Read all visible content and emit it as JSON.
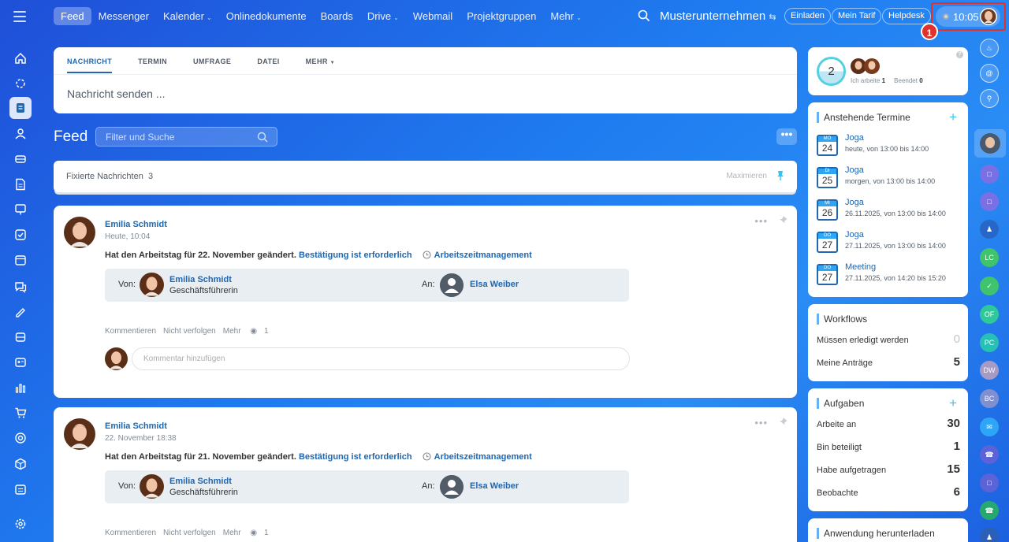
{
  "topbar": {
    "nav": [
      {
        "label": "Feed",
        "active": true,
        "caret": false
      },
      {
        "label": "Messenger",
        "caret": false
      },
      {
        "label": "Kalender",
        "caret": true
      },
      {
        "label": "Onlinedokumente",
        "caret": false
      },
      {
        "label": "Boards",
        "caret": false
      },
      {
        "label": "Drive",
        "caret": true
      },
      {
        "label": "Webmail",
        "caret": false
      },
      {
        "label": "Projektgruppen",
        "caret": false
      },
      {
        "label": "Mehr",
        "caret": true
      }
    ],
    "company": "Musterunternehmen",
    "invite": "Einladen",
    "tariff": "Mein Tarif",
    "helpdesk": "Helpdesk",
    "time": "10:05",
    "step_badge": "1"
  },
  "composer": {
    "tabs": [
      "NACHRICHT",
      "TERMIN",
      "UMFRAGE",
      "DATEI",
      "MEHR"
    ],
    "placeholder": "Nachricht senden ..."
  },
  "feed": {
    "title": "Feed",
    "filter_placeholder": "Filter und Suche",
    "more": "•••",
    "pinned": {
      "label": "Fixierte Nachrichten",
      "count": "3",
      "maximize": "Maximieren"
    },
    "posts": [
      {
        "author": "Emilia Schmidt",
        "date": "Heute, 10:04",
        "message": "Hat den Arbeitstag für 22. November geändert.",
        "confirm": "Bestätigung ist erforderlich",
        "module": "Arbeitszeitmanagement",
        "from_label": "Von:",
        "from_name": "Emilia Schmidt",
        "from_role": "Geschäftsführerin",
        "to_label": "An:",
        "to_name": "Elsa Weiber",
        "actions": [
          "Kommentieren",
          "Nicht verfolgen",
          "Mehr"
        ],
        "views": "1",
        "comment_placeholder": "Kommentar hinzufügen"
      },
      {
        "author": "Emilia Schmidt",
        "date": "22. November 18:38",
        "message": "Hat den Arbeitstag für 21. November geändert.",
        "confirm": "Bestätigung ist erforderlich",
        "module": "Arbeitszeitmanagement",
        "from_label": "Von:",
        "from_name": "Emilia Schmidt",
        "from_role": "Geschäftsführerin",
        "to_label": "An:",
        "to_name": "Elsa Weiber",
        "actions": [
          "Kommentieren",
          "Nicht verfolgen",
          "Mehr"
        ],
        "views": "1"
      }
    ]
  },
  "right": {
    "worktime": {
      "count": "2",
      "working_label": "Ich arbeite",
      "working": "1",
      "finished_label": "Beendet",
      "finished": "0"
    },
    "events": {
      "title": "Anstehende Termine",
      "items": [
        {
          "day": "MO",
          "date": "24",
          "name": "Joga",
          "time": "heute, von 13:00 bis 14:00"
        },
        {
          "day": "DI",
          "date": "25",
          "name": "Joga",
          "time": "morgen, von 13:00 bis 14:00"
        },
        {
          "day": "MI",
          "date": "26",
          "name": "Joga",
          "time": "26.11.2025, von 13:00 bis 14:00"
        },
        {
          "day": "DO",
          "date": "27",
          "name": "Joga",
          "time": "27.11.2025, von 13:00 bis 14:00"
        },
        {
          "day": "DO",
          "date": "27",
          "name": "Meeting",
          "time": "27.11.2025, von 14:20 bis 15:20"
        }
      ]
    },
    "workflows": {
      "title": "Workflows",
      "rows": [
        {
          "label": "Müssen erledigt werden",
          "value": "0"
        },
        {
          "label": "Meine Anträge",
          "value": "5"
        }
      ]
    },
    "tasks": {
      "title": "Aufgaben",
      "rows": [
        {
          "label": "Arbeite an",
          "value": "30"
        },
        {
          "label": "Bin beteiligt",
          "value": "1"
        },
        {
          "label": "Habe aufgetragen",
          "value": "15"
        },
        {
          "label": "Beobachte",
          "value": "6"
        }
      ]
    },
    "download": {
      "title": "Anwendung herunterladen"
    }
  },
  "rsidebar": {
    "items": [
      {
        "text": "LC",
        "color": "#3fc46d"
      },
      {
        "text": "OF",
        "color": "#2fc89a"
      },
      {
        "text": "PC",
        "color": "#27c0b5"
      },
      {
        "text": "DW",
        "color": "#a79bc5"
      },
      {
        "text": "BC",
        "color": "#7f8fd0"
      }
    ]
  },
  "colors": {
    "accent": "#2067b0",
    "brand_bg": "#1f7cf0",
    "badge": "#e0322a"
  }
}
